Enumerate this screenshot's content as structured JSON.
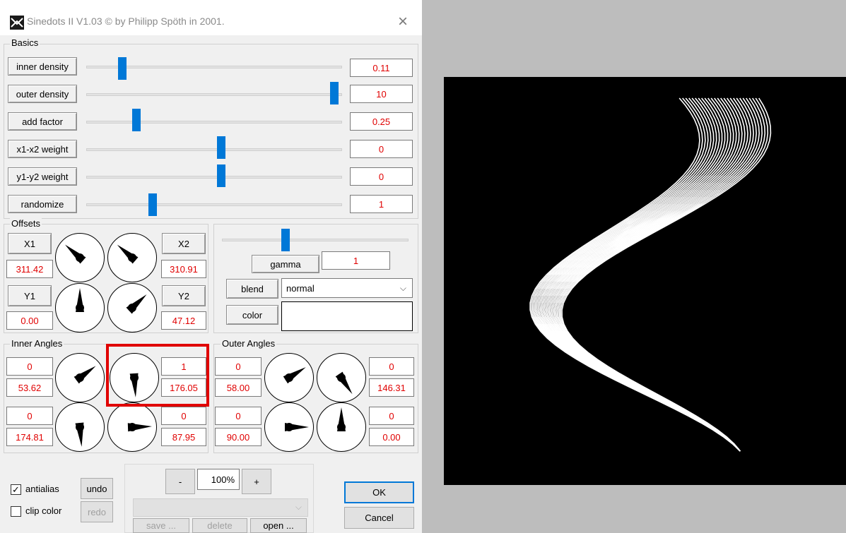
{
  "title": "Sinedots II V1.03 © by Philipp Spöth in 2001.",
  "close_glyph": "×",
  "basics": {
    "label": "Basics",
    "rows": [
      {
        "label": "inner density",
        "value": "0.11",
        "pos": 0.08
      },
      {
        "label": "outer density",
        "value": "10",
        "pos": 0.98
      },
      {
        "label": "add factor",
        "value": "0.25",
        "pos": 0.14
      },
      {
        "label": "x1-x2 weight",
        "value": "0",
        "pos": 0.5
      },
      {
        "label": "y1-y2 weight",
        "value": "0",
        "pos": 0.5
      },
      {
        "label": "randomize",
        "value": "1",
        "pos": 0.21
      }
    ]
  },
  "offsets": {
    "label": "Offsets",
    "x1_label": "X1",
    "x1_value": "311.42",
    "x2_label": "X2",
    "x2_value": "310.91",
    "y1_label": "Y1",
    "y1_value": "0.00",
    "y2_label": "Y2",
    "y2_value": "47.12",
    "dials": [
      311.42,
      310.91,
      0.0,
      47.12
    ]
  },
  "render": {
    "gamma_pos": 0.34,
    "gamma_label": "gamma",
    "gamma_value": "1",
    "blend_label": "blend",
    "blend_value": "normal",
    "color_label": "color",
    "color_value": "#ffffff"
  },
  "inner_angles": {
    "label": "Inner Angles",
    "a_top": "0",
    "a_bottom": "53.62",
    "b_top": "1",
    "b_bottom": "176.05",
    "c_top": "0",
    "c_bottom": "174.81",
    "d_top": "0",
    "d_bottom": "87.95",
    "dials": [
      53.62,
      176.05,
      174.81,
      87.95
    ]
  },
  "outer_angles": {
    "label": "Outer Angles",
    "a_top": "0",
    "a_bottom": "58.00",
    "b_top": "0",
    "b_bottom": "146.31",
    "c_top": "0",
    "c_bottom": "90.00",
    "d_top": "0",
    "d_bottom": "0.00",
    "dials": [
      58.0,
      146.31,
      90.0,
      0.0
    ]
  },
  "bottom": {
    "antialias_label": "antialias",
    "antialias_checked": true,
    "clip_label": "clip color",
    "clip_checked": false,
    "undo_label": "undo",
    "redo_label": "redo",
    "minus_label": "-",
    "zoom_value": "100%",
    "plus_label": "+",
    "preset_value": "",
    "save_label": "save ...",
    "delete_label": "delete",
    "open_label": "open ...",
    "ok_label": "OK",
    "cancel_label": "Cancel"
  },
  "colors": {
    "accent": "#0078d7",
    "value_text": "#e00000",
    "highlight": "#e00000",
    "preview_bg": "#000000"
  }
}
